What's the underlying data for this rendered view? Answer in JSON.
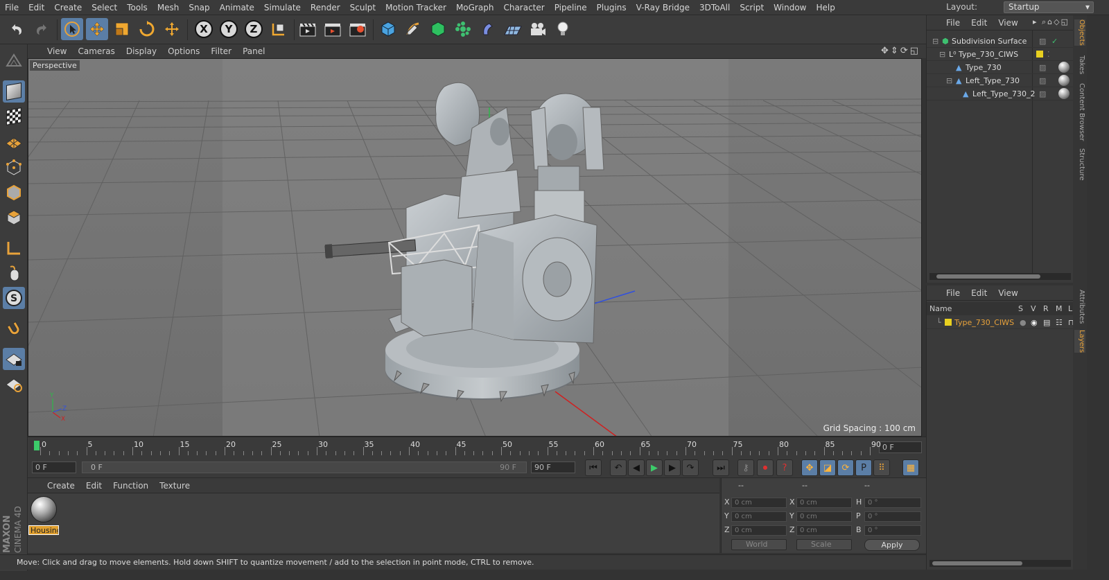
{
  "menu": [
    "File",
    "Edit",
    "Create",
    "Select",
    "Tools",
    "Mesh",
    "Snap",
    "Animate",
    "Simulate",
    "Render",
    "Sculpt",
    "Motion Tracker",
    "MoGraph",
    "Character",
    "Pipeline",
    "Plugins",
    "V-Ray Bridge",
    "3DToAll",
    "Script",
    "Window",
    "Help"
  ],
  "layout": {
    "label": "Layout:",
    "value": "Startup"
  },
  "toolbar_axes": [
    "X",
    "Y",
    "Z"
  ],
  "viewport": {
    "menu": [
      "View",
      "Cameras",
      "Display",
      "Options",
      "Filter",
      "Panel"
    ],
    "label": "Perspective",
    "grid_spacing": "Grid Spacing : 100 cm"
  },
  "timeline": {
    "labels": [
      "0",
      "5",
      "10",
      "15",
      "20",
      "25",
      "30",
      "35",
      "40",
      "45",
      "50",
      "55",
      "60",
      "65",
      "70",
      "75",
      "80",
      "85",
      "90"
    ],
    "end_field": "0 F"
  },
  "transport": {
    "start": "0 F",
    "range_start": "0 F",
    "range_end": "90 F",
    "end": "90 F"
  },
  "material": {
    "menu": [
      "Create",
      "Edit",
      "Function",
      "Texture"
    ],
    "name": "Housing"
  },
  "coordinates": {
    "header": [
      "--",
      "--",
      "--"
    ],
    "rows": [
      {
        "a": "X",
        "av": "0 cm",
        "b": "X",
        "bv": "0 cm",
        "c": "H",
        "cv": "0 °"
      },
      {
        "a": "Y",
        "av": "0 cm",
        "b": "Y",
        "bv": "0 cm",
        "c": "P",
        "cv": "0 °"
      },
      {
        "a": "Z",
        "av": "0 cm",
        "b": "Z",
        "bv": "0 cm",
        "c": "B",
        "cv": "0 °"
      }
    ],
    "space": "World",
    "mode": "Scale",
    "apply": "Apply"
  },
  "status": "Move: Click and drag to move elements. Hold down SHIFT to quantize movement / add to the selection in point mode, CTRL to remove.",
  "branding": {
    "maxon": "MAXON",
    "cinema": "CINEMA 4D"
  },
  "objects": {
    "menu": [
      "File",
      "Edit",
      "View"
    ],
    "items": [
      {
        "name": "Subdivision Surface"
      },
      {
        "name": "Type_730_CIWS"
      },
      {
        "name": "Type_730"
      },
      {
        "name": "Left_Type_730"
      },
      {
        "name": "Left_Type_730_2"
      }
    ]
  },
  "layers": {
    "menu": [
      "File",
      "Edit",
      "View"
    ],
    "headers": [
      "Name",
      "S",
      "V",
      "R",
      "M",
      "L"
    ],
    "items": [
      {
        "name": "Type_730_CIWS"
      }
    ]
  },
  "right_tabs": [
    "Objects",
    "Takes",
    "Content Browser",
    "Structure",
    "Attributes",
    "Layers"
  ],
  "colors": {
    "accent": "#5b7ea6",
    "highlight": "#e8a23a",
    "playhead": "#3ccc6a",
    "layer_color": "#e8d020"
  }
}
